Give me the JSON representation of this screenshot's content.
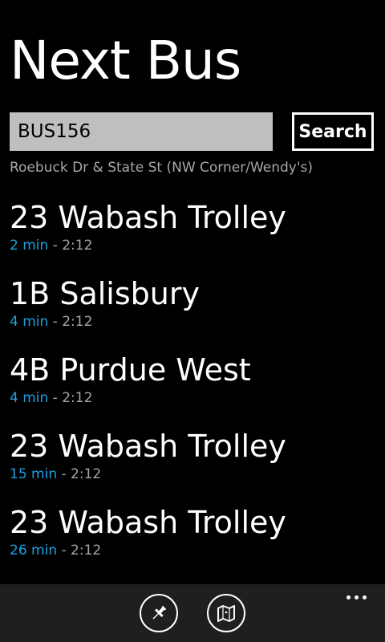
{
  "page": {
    "title": "Next Bus"
  },
  "search": {
    "value": "BUS156",
    "button_label": "Search"
  },
  "stop": {
    "name": "Roebuck Dr & State St (NW Corner/Wendy's)"
  },
  "arrivals": [
    {
      "route": "23 Wabash Trolley",
      "eta": "2 min",
      "separator": " - ",
      "time": "2:12"
    },
    {
      "route": "1B Salisbury",
      "eta": "4 min",
      "separator": " - ",
      "time": "2:12"
    },
    {
      "route": "4B Purdue West",
      "eta": "4 min",
      "separator": " - ",
      "time": "2:12"
    },
    {
      "route": "23 Wabash Trolley",
      "eta": "15 min",
      "separator": " - ",
      "time": "2:12"
    },
    {
      "route": "23 Wabash Trolley",
      "eta": "26 min",
      "separator": " - ",
      "time": "2:12"
    }
  ],
  "appbar": {
    "buttons": [
      {
        "icon": "pin-icon"
      },
      {
        "icon": "map-icon"
      }
    ],
    "more_icon": "ellipsis-icon"
  },
  "colors": {
    "background": "#000000",
    "accent": "#1ba1e2",
    "secondary_text": "#a6a6a6",
    "input_background": "#bfbfbf",
    "appbar_background": "#1f1f1f"
  }
}
